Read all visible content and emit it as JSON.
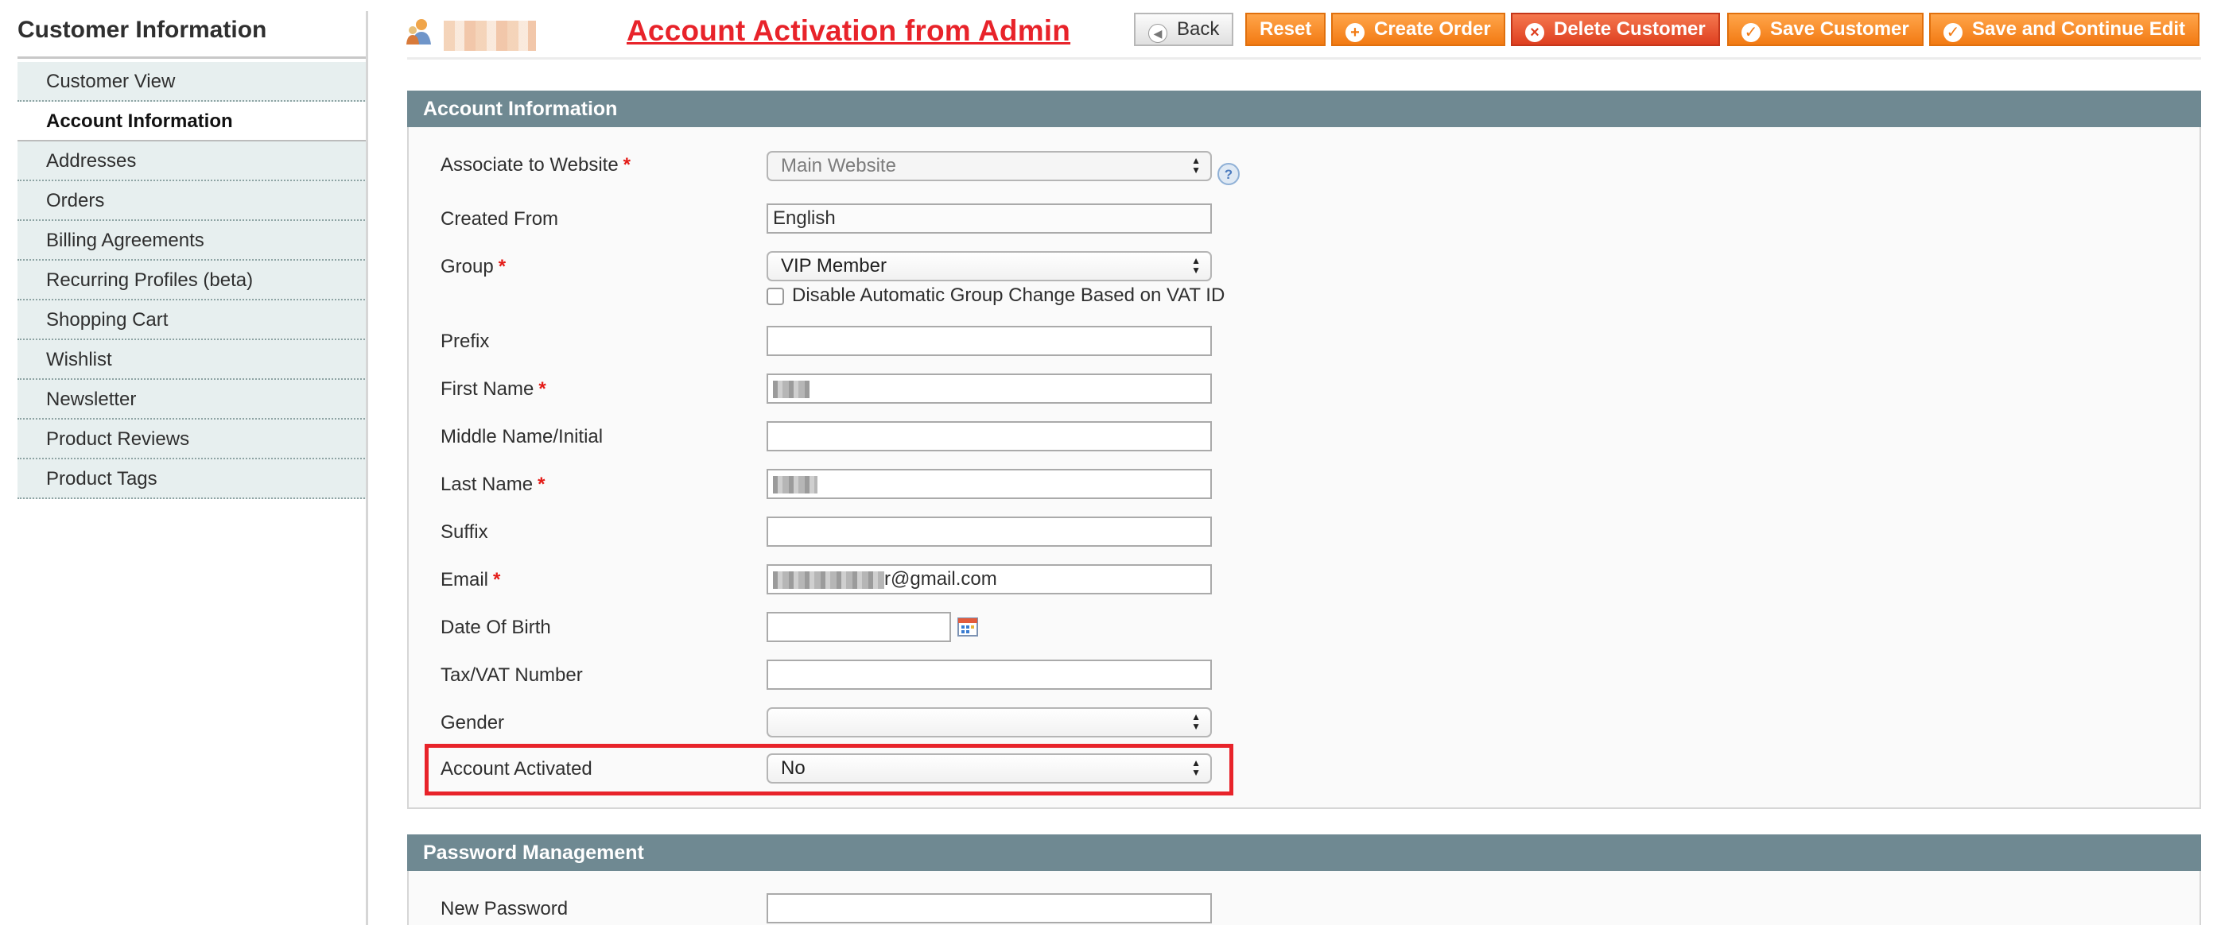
{
  "sidebar": {
    "title": "Customer Information",
    "items": [
      {
        "label": "Customer View"
      },
      {
        "label": "Account Information"
      },
      {
        "label": "Addresses"
      },
      {
        "label": "Orders"
      },
      {
        "label": "Billing Agreements"
      },
      {
        "label": "Recurring Profiles (beta)"
      },
      {
        "label": "Shopping Cart"
      },
      {
        "label": "Wishlist"
      },
      {
        "label": "Newsletter"
      },
      {
        "label": "Product Reviews"
      },
      {
        "label": "Product Tags"
      }
    ],
    "active_item": "Account Information"
  },
  "header": {
    "title": "Account Activation from Admin",
    "buttons": {
      "back": "Back",
      "reset": "Reset",
      "create_order": "Create Order",
      "delete_customer": "Delete Customer",
      "save_customer": "Save Customer",
      "save_continue": "Save and Continue Edit"
    }
  },
  "account_information": {
    "section_title": "Account Information",
    "fields": {
      "website": {
        "label": "Associate to Website",
        "value": "Main Website"
      },
      "created_from": {
        "label": "Created From",
        "value": "English"
      },
      "group": {
        "label": "Group",
        "value": "VIP Member",
        "checkbox_label": "Disable Automatic Group Change Based on VAT ID"
      },
      "prefix": {
        "label": "Prefix",
        "value": ""
      },
      "first_name": {
        "label": "First Name"
      },
      "middle_name": {
        "label": "Middle Name/Initial",
        "value": ""
      },
      "last_name": {
        "label": "Last Name"
      },
      "suffix": {
        "label": "Suffix",
        "value": ""
      },
      "email": {
        "label": "Email",
        "value_visible_part": "r@gmail.com"
      },
      "dob": {
        "label": "Date Of Birth",
        "value": ""
      },
      "taxvat": {
        "label": "Tax/VAT Number",
        "value": ""
      },
      "gender": {
        "label": "Gender",
        "value": ""
      },
      "account_activated": {
        "label": "Account Activated",
        "value": "No"
      }
    }
  },
  "password_management": {
    "section_title": "Password Management",
    "fields": {
      "new_password": {
        "label": "New Password",
        "value": ""
      }
    }
  },
  "colors": {
    "accent_orange": "#f27a13",
    "delete_red": "#de3f20",
    "title_red": "#e8232a",
    "section_header": "#6f8992"
  }
}
